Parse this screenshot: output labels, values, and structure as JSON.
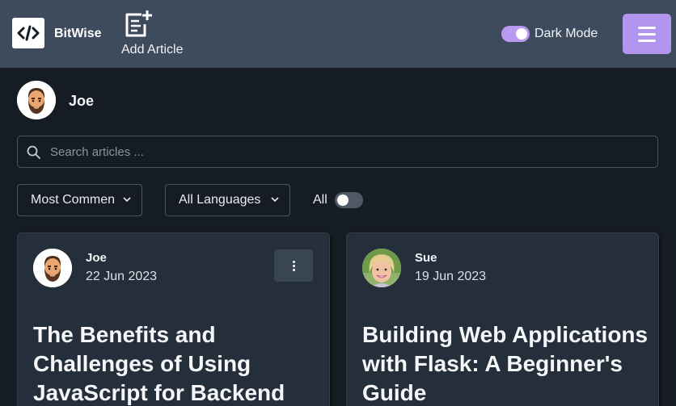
{
  "header": {
    "brand": "BitWise",
    "add_article_label": "Add Article",
    "dark_mode_label": "Dark Mode",
    "dark_mode_on": true,
    "logo_icon": "code-brackets-icon",
    "menu_icon": "hamburger-icon",
    "accent_color": "#b394ef"
  },
  "user": {
    "name": "Joe",
    "avatar_icon": "bearded-man-avatar"
  },
  "search": {
    "placeholder": "Search articles ...",
    "value": ""
  },
  "filters": {
    "sort_selected": "Most Commen",
    "language_selected": "All Languages",
    "all_label": "All",
    "all_on": false
  },
  "articles": [
    {
      "author": "Joe",
      "date": "22 Jun 2023",
      "title": "The Benefits and Challenges of Using JavaScript for Backend",
      "avatar_icon": "bearded-man-avatar",
      "has_menu": true
    },
    {
      "author": "Sue",
      "date": "19 Jun 2023",
      "title": "Building Web Applications with Flask: A Beginner's Guide",
      "avatar_icon": "woman-photo-avatar",
      "has_menu": false
    }
  ]
}
